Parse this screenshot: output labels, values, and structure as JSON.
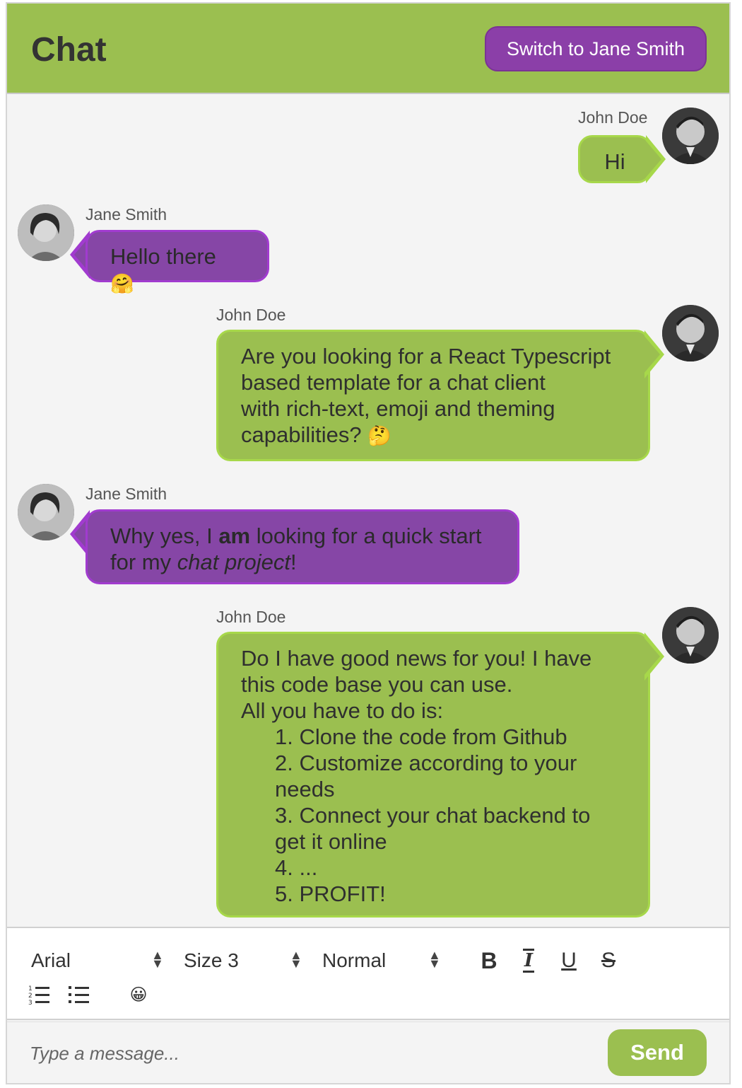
{
  "header": {
    "title": "Chat",
    "switch_label": "Switch to Jane Smith"
  },
  "messages": [
    {
      "sender": "John Doe",
      "direction": "outgoing",
      "text": "Hi"
    },
    {
      "sender": "Jane Smith",
      "direction": "incoming",
      "text": "Hello there",
      "emoji": "🤗"
    },
    {
      "sender": "John Doe",
      "direction": "outgoing",
      "lines": [
        "Are you looking for a React Typescript",
        "based template for a chat client",
        "with rich-text, emoji and theming",
        "capabilities?"
      ],
      "emoji": "🤔"
    },
    {
      "sender": "Jane Smith",
      "direction": "incoming",
      "line1_pre": "Why yes, I ",
      "line1_bold": "am",
      "line1_post": " looking for a quick start",
      "line2_pre": "for my ",
      "line2_italic": "chat project",
      "line2_post": "!"
    },
    {
      "sender": "John Doe",
      "direction": "outgoing",
      "lines": [
        "Do I have good news for you! I have",
        "this code base you can use.",
        "All you have to do is:"
      ],
      "list": [
        "1. Clone the code from Github",
        "2. Customize according to your",
        "needs",
        "3. Connect your chat backend to",
        "get it online",
        "4. ...",
        "5. PROFIT!"
      ]
    }
  ],
  "toolbar": {
    "font": "Arial",
    "size": "Size 3",
    "format": "Normal",
    "bold_icon": "bold-icon",
    "italic_icon": "italic-icon",
    "underline_icon": "underline-icon",
    "strike_icon": "strikethrough-icon",
    "ordered_list_icon": "ordered-list-icon",
    "bullet_list_icon": "bullet-list-icon",
    "emoji_icon": "emoji-picker-icon",
    "emoji_glyph": "😀"
  },
  "composer": {
    "placeholder": "Type a message...",
    "send_label": "Send"
  },
  "colors": {
    "primary_green": "#9bbf50",
    "primary_purple": "#8646a6",
    "green_border": "#a7d84a",
    "purple_border": "#a13bcf"
  }
}
